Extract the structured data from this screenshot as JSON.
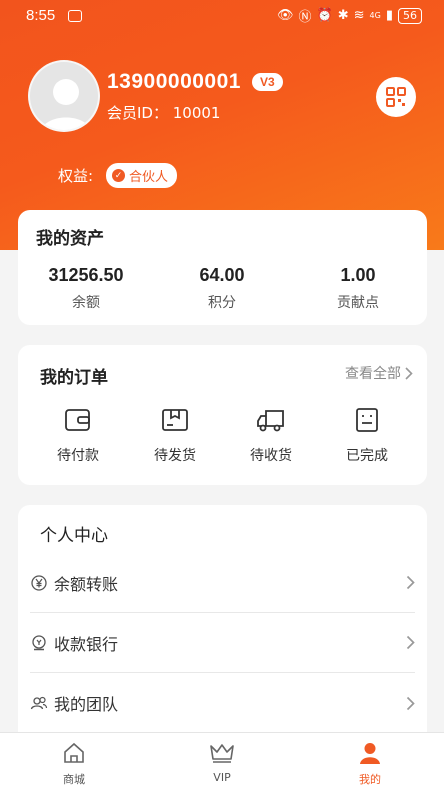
{
  "status": {
    "time": "8:55",
    "network": "4G",
    "battery": "56"
  },
  "profile": {
    "phone": "13900000001",
    "level": "V3",
    "member_id": "会员ID：  10001",
    "rights_label": "权益:",
    "rights_badge": "合伙人"
  },
  "assets": {
    "title": "我的资产",
    "items": [
      {
        "value": "31256.50",
        "label": "余额"
      },
      {
        "value": "64.00",
        "label": "积分"
      },
      {
        "value": "1.00",
        "label": "贡献点"
      }
    ]
  },
  "orders": {
    "title": "我的订单",
    "view_all": "查看全部",
    "items": [
      {
        "label": "待付款",
        "icon": "wallet-icon"
      },
      {
        "label": "待发货",
        "icon": "package-icon"
      },
      {
        "label": "待收货",
        "icon": "truck-icon"
      },
      {
        "label": "已完成",
        "icon": "document-icon"
      }
    ]
  },
  "personal_center": {
    "title": "个人中心",
    "items": [
      {
        "label": "余额转账",
        "icon": "yen-icon"
      },
      {
        "label": "收款银行",
        "icon": "bank-icon"
      },
      {
        "label": "我的团队",
        "icon": "team-icon"
      }
    ]
  },
  "tabbar": {
    "items": [
      {
        "label": "商城",
        "icon": "home-icon"
      },
      {
        "label": "VIP",
        "icon": "crown-icon"
      },
      {
        "label": "我的",
        "icon": "user-icon"
      }
    ],
    "active": "我的"
  },
  "colors": {
    "accent": "#f05a24",
    "background": "#f4f4f4"
  }
}
